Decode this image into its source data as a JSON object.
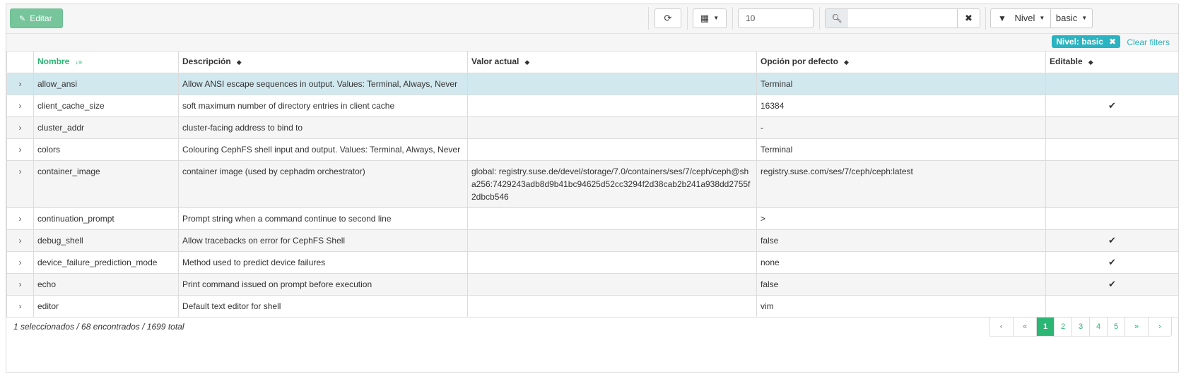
{
  "toolbar": {
    "edit_label": "Editar",
    "page_size_value": "10",
    "search_placeholder": "",
    "filter_label": "Nivel",
    "filter_value": "basic"
  },
  "filters": {
    "active_badge": "Nivel: basic",
    "clear_label": "Clear filters"
  },
  "table": {
    "headers": [
      "Nombre",
      "Descripción",
      "Valor actual",
      "Opción por defecto",
      "Editable"
    ],
    "rows": [
      {
        "name": "allow_ansi",
        "desc": "Allow ANSI escape sequences in output. Values: Terminal, Always, Never",
        "current": "",
        "default": "Terminal",
        "editable": ""
      },
      {
        "name": "client_cache_size",
        "desc": "soft maximum number of directory entries in client cache",
        "current": "",
        "default": "16384",
        "editable": "✔"
      },
      {
        "name": "cluster_addr",
        "desc": "cluster-facing address to bind to",
        "current": "",
        "default": "-",
        "editable": ""
      },
      {
        "name": "colors",
        "desc": "Colouring CephFS shell input and output. Values: Terminal, Always, Never",
        "current": "",
        "default": "Terminal",
        "editable": ""
      },
      {
        "name": "container_image",
        "desc": "container image (used by cephadm orchestrator)",
        "current": "global: registry.suse.de/devel/storage/7.0/containers/ses/7/ceph/ceph@sha256:7429243adb8d9b41bc94625d52cc3294f2d38cab2b241a938dd2755f2dbcb546",
        "default": "registry.suse.com/ses/7/ceph/ceph:latest",
        "editable": ""
      },
      {
        "name": "continuation_prompt",
        "desc": "Prompt string when a command continue to second line",
        "current": "",
        "default": ">",
        "editable": ""
      },
      {
        "name": "debug_shell",
        "desc": "Allow tracebacks on error for CephFS Shell",
        "current": "",
        "default": "false",
        "editable": "✔"
      },
      {
        "name": "device_failure_prediction_mode",
        "desc": "Method used to predict device failures",
        "current": "",
        "default": "none",
        "editable": "✔"
      },
      {
        "name": "echo",
        "desc": "Print command issued on prompt before execution",
        "current": "",
        "default": "false",
        "editable": "✔"
      },
      {
        "name": "editor",
        "desc": "Default text editor for shell",
        "current": "",
        "default": "vim",
        "editable": ""
      }
    ]
  },
  "footer": {
    "summary": "1 seleccionados / 68 encontrados / 1699 total",
    "pages": [
      "1",
      "2",
      "3",
      "4",
      "5"
    ]
  },
  "colors": {
    "accent": "#2bb673",
    "badge": "#2ab3c0",
    "selected_row": "#d1e8ef"
  }
}
